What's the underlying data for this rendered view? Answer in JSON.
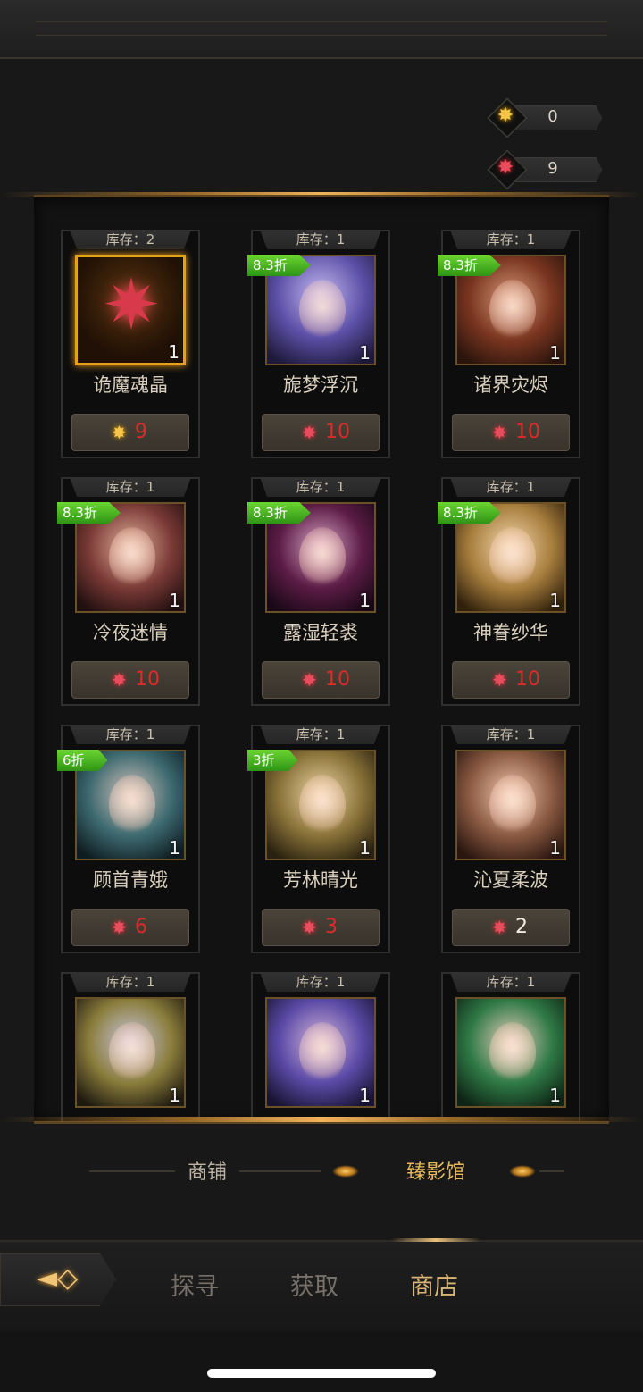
{
  "currencies": [
    {
      "icon": "gold-gem-icon",
      "value": "0"
    },
    {
      "icon": "red-gem-icon",
      "value": "9"
    }
  ],
  "cards": [
    {
      "stock": "库存：2",
      "name": "诡魔魂晶",
      "qty": "1",
      "discount": "",
      "price": "9",
      "currency": "gold",
      "theme": "special"
    },
    {
      "stock": "库存：1",
      "name": "旎梦浮沉",
      "qty": "1",
      "discount": "8.3折",
      "price": "10",
      "currency": "red",
      "theme": "purple"
    },
    {
      "stock": "库存：1",
      "name": "诸界灾烬",
      "qty": "1",
      "discount": "8.3折",
      "price": "10",
      "currency": "red",
      "theme": "auburn"
    },
    {
      "stock": "库存：1",
      "name": "冷夜迷情",
      "qty": "1",
      "discount": "8.3折",
      "price": "10",
      "currency": "red",
      "theme": "red"
    },
    {
      "stock": "库存：1",
      "name": "露湿轻裘",
      "qty": "1",
      "discount": "8.3折",
      "price": "10",
      "currency": "red",
      "theme": "pinkdk"
    },
    {
      "stock": "库存：1",
      "name": "神眷纱华",
      "qty": "1",
      "discount": "8.3折",
      "price": "10",
      "currency": "red",
      "theme": "blonde"
    },
    {
      "stock": "库存：1",
      "name": "顾首青娥",
      "qty": "1",
      "discount": "6折",
      "price": "6",
      "currency": "red",
      "theme": "teal"
    },
    {
      "stock": "库存：1",
      "name": "芳林晴光",
      "qty": "1",
      "discount": "3折",
      "price": "3",
      "currency": "red",
      "theme": "gold2"
    },
    {
      "stock": "库存：1",
      "name": "沁夏柔波",
      "qty": "1",
      "discount": "",
      "price": "2",
      "currency": "red",
      "theme": "brown"
    },
    {
      "stock": "库存：1",
      "name": "",
      "qty": "1",
      "discount": "",
      "price": "",
      "currency": "red",
      "theme": "elf"
    },
    {
      "stock": "库存：1",
      "name": "",
      "qty": "1",
      "discount": "",
      "price": "",
      "currency": "red",
      "theme": "violet"
    },
    {
      "stock": "库存：1",
      "name": "",
      "qty": "1",
      "discount": "",
      "price": "",
      "currency": "red",
      "theme": "green"
    }
  ],
  "subtabs": {
    "shop": "商铺",
    "gallery": "臻影馆",
    "active": "gallery"
  },
  "nav": {
    "explore": "探寻",
    "obtain": "获取",
    "store": "商店",
    "active": "store"
  },
  "colors": {
    "accent_gold": "#e7b95b",
    "price_red": "#e02a2a",
    "discount_green": "#4fb822"
  }
}
